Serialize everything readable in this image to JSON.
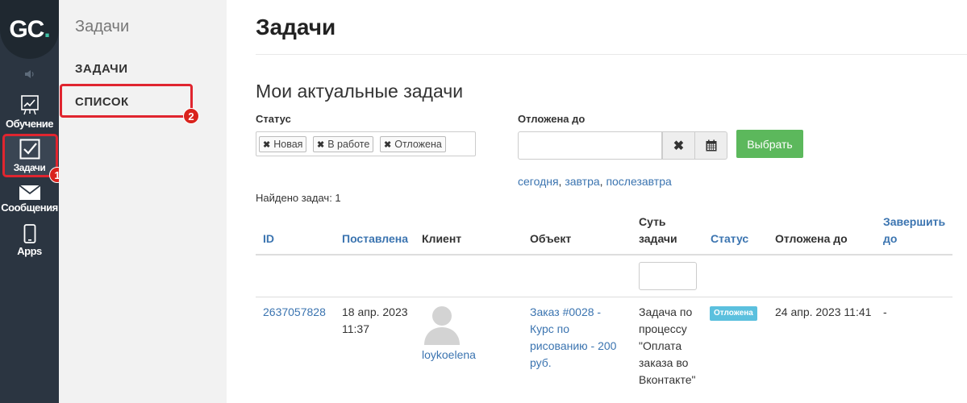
{
  "rail": {
    "logo": {
      "text_main": "GC",
      "text_dot": "."
    },
    "items": [
      {
        "label": "Обучение",
        "icon": "chart-icon"
      },
      {
        "label": "Задачи",
        "icon": "checkbox-icon"
      },
      {
        "label": "Сообщения",
        "icon": "envelope-icon"
      },
      {
        "label": "Apps",
        "icon": "phone-icon"
      }
    ],
    "badge1": "1"
  },
  "submenu": {
    "title": "Задачи",
    "items": [
      {
        "label": "ЗАДАЧИ"
      },
      {
        "label": "СПИСОК"
      }
    ],
    "badge2": "2"
  },
  "main": {
    "page_title": "Задачи",
    "section_title": "Мои актуальные задачи",
    "filters": {
      "status_label": "Статус",
      "status_tags": [
        "Новая",
        "В работе",
        "Отложена"
      ],
      "postponed_label": "Отложена до",
      "choose_button": "Выбрать",
      "quick_links": [
        "сегодня",
        "завтра",
        "послезавтра"
      ]
    },
    "found": "Найдено задач: 1",
    "table": {
      "headers": {
        "id": "ID",
        "created": "Поставлена",
        "client": "Клиент",
        "object": "Объект",
        "essence_1": "Суть",
        "essence_2": "задачи",
        "status": "Статус",
        "postponed": "Отложена до",
        "finish_1": "Завершить",
        "finish_2": "до"
      },
      "row": {
        "id": "2637057828",
        "created_date": "18 апр. 2023",
        "created_time": "11:37",
        "client": "loykoelena",
        "object_1": "Заказ #0028 -",
        "object_2": "Курс по",
        "object_3": "рисованию - 200",
        "object_4": "руб.",
        "essence_1": "Задача по",
        "essence_2": "процессу",
        "essence_3": "\"Оплата",
        "essence_4": "заказа во",
        "essence_5": "Вконтакте\"",
        "status": "Отложена",
        "postponed": "24 апр. 2023 11:41",
        "finish": "-"
      }
    }
  },
  "colors": {
    "rail_bg": "#2b3541",
    "accent_green": "#5cb85c",
    "link_blue": "#3b74b0",
    "highlight_red": "#e0252f",
    "status_label": "#5bc0de"
  }
}
